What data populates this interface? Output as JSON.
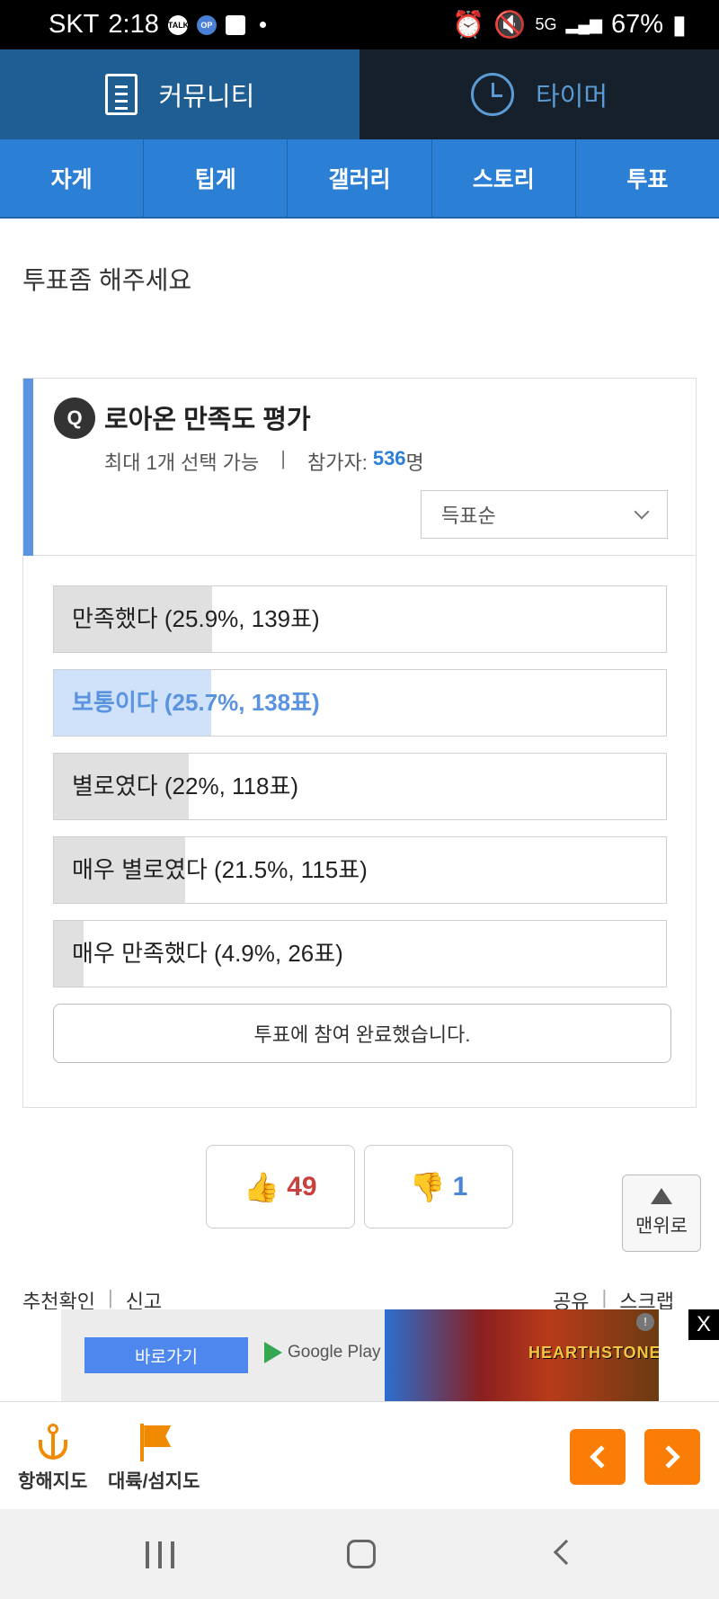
{
  "status_bar": {
    "carrier": "SKT",
    "time": "2:18",
    "network": "5G",
    "battery": "67%",
    "icons": [
      "talk-icon",
      "opgg-icon",
      "note-icon",
      "alarm-icon",
      "mute-icon",
      "signal-icon",
      "battery-icon"
    ]
  },
  "top_nav": {
    "community_label": "커뮤니티",
    "timer_label": "타이머"
  },
  "sub_nav": {
    "tabs": [
      "자게",
      "팁게",
      "갤러리",
      "스토리",
      "투표"
    ]
  },
  "post": {
    "title": "투표좀 해주세요"
  },
  "poll": {
    "badge": "Q",
    "question": "로아온 만족도 평가",
    "max_select": "최대 1개 선택 가능",
    "separator": "|",
    "participants_label": "참가자:",
    "participants_count": "536",
    "participants_unit": "명",
    "sort_value": "득표순",
    "options": [
      {
        "label": "만족했다 (25.9%, 139표)",
        "percent": 25.9,
        "selected": false
      },
      {
        "label": "보통이다 (25.7%, 138표)",
        "percent": 25.7,
        "selected": true
      },
      {
        "label": "별로였다 (22%, 118표)",
        "percent": 22,
        "selected": false
      },
      {
        "label": "매우 별로였다 (21.5%, 115표)",
        "percent": 21.5,
        "selected": false
      },
      {
        "label": "매우 만족했다 (4.9%, 26표)",
        "percent": 4.9,
        "selected": false
      }
    ],
    "done_label": "투표에 참여 완료했습니다."
  },
  "votes": {
    "up_count": "49",
    "down_count": "1",
    "to_top_label": "맨위로"
  },
  "footer_links": {
    "recommend_check": "추천확인",
    "report": "신고",
    "share": "공유",
    "scrap": "스크랩",
    "separator": "|"
  },
  "ad": {
    "cta": "바로가기",
    "store": "Google Play",
    "brand": "HEARTHSTONE",
    "close": "X",
    "info": "!"
  },
  "bottom_bar": {
    "anchor_label": "항해지도",
    "map_label": "대륙/섬지도"
  },
  "colors": {
    "accent": "#2b7fd4",
    "nav_active": "#1f5e93",
    "nav_inactive": "#15202b",
    "up_vote": "#c9413e",
    "down_vote": "#4a86d8",
    "orange": "#f97d07"
  }
}
